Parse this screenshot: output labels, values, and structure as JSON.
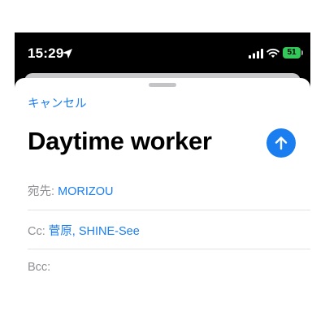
{
  "status_bar": {
    "time": "15:29",
    "battery_level": "51",
    "icons": [
      "location-arrow-icon",
      "signal-icon",
      "wifi-icon",
      "battery-icon"
    ]
  },
  "compose": {
    "cancel_label": "キャンセル",
    "subject": "Daytime worker",
    "to": {
      "label": "宛先:",
      "value": "MORIZOU"
    },
    "cc": {
      "label": "Cc:",
      "value": "菅原, SHINE-See"
    },
    "bcc": {
      "label": "Bcc:",
      "value": ""
    }
  },
  "colors": {
    "accent": "#1b7ef0",
    "battery": "#34c759",
    "label_gray": "#8e8e93"
  }
}
